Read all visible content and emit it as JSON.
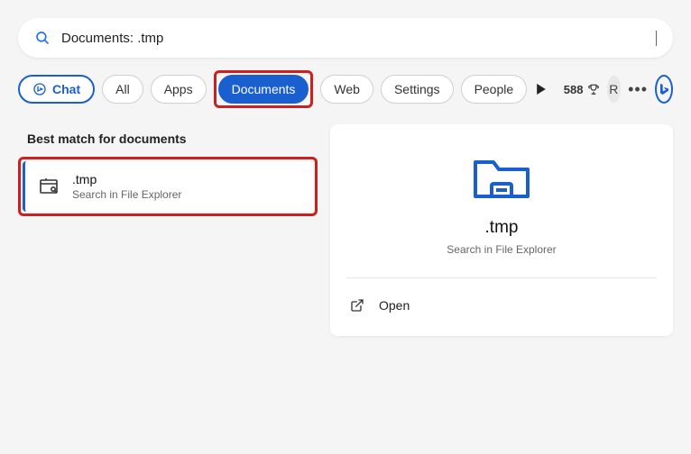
{
  "search": {
    "value": "Documents: .tmp"
  },
  "filters": {
    "chat": "Chat",
    "all": "All",
    "apps": "Apps",
    "documents": "Documents",
    "web": "Web",
    "settings": "Settings",
    "people": "People"
  },
  "topbar": {
    "points": "588",
    "user_initial": "R"
  },
  "results": {
    "section_title": "Best match for documents",
    "item": {
      "title": ".tmp",
      "subtitle": "Search in File Explorer"
    }
  },
  "preview": {
    "title": ".tmp",
    "subtitle": "Search in File Explorer",
    "actions": {
      "open": "Open"
    }
  }
}
